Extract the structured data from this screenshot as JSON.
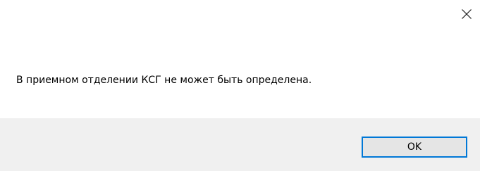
{
  "dialog": {
    "message": "В приемном отделении КСГ не может быть определена.",
    "close_icon": "close-icon",
    "ok_label": "OK"
  },
  "colors": {
    "background": "#ffffff",
    "footer_background": "#f0f0f0",
    "ok_button_border": "#0078d7",
    "ok_button_background": "#e5e5e5"
  }
}
